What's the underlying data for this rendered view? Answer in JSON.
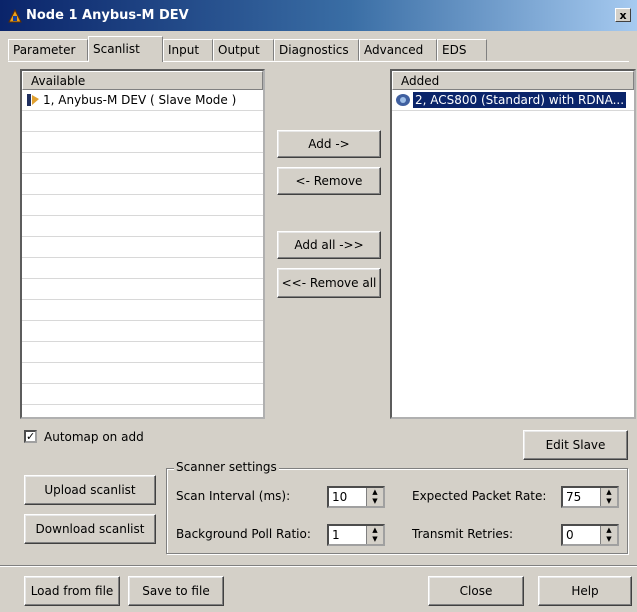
{
  "window": {
    "title": "Node 1 Anybus-M DEV",
    "close_label": "x"
  },
  "tabs": [
    {
      "label": "Parameter"
    },
    {
      "label": "Scanlist"
    },
    {
      "label": "Input"
    },
    {
      "label": "Output"
    },
    {
      "label": "Diagnostics"
    },
    {
      "label": "Advanced"
    },
    {
      "label": "EDS"
    }
  ],
  "available": {
    "header": "Available",
    "items": [
      {
        "label": "1, Anybus-M DEV ( Slave Mode )",
        "icon": "device-icon"
      }
    ]
  },
  "added": {
    "header": "Added",
    "items": [
      {
        "label": "2, ACS800 (Standard) with RDNA...",
        "icon": "drive-icon",
        "selected": true
      }
    ]
  },
  "buttons": {
    "add": "Add ->",
    "remove": "<- Remove",
    "add_all": "Add all ->>",
    "remove_all": "<<- Remove all",
    "edit_slave": "Edit Slave",
    "upload_scanlist": "Upload scanlist",
    "download_scanlist": "Download scanlist",
    "load_from_file": "Load from file",
    "save_to_file": "Save to file",
    "close": "Close",
    "help": "Help"
  },
  "automap": {
    "label": "Automap on add",
    "checked": true,
    "mark": "✓"
  },
  "scanner_settings": {
    "title": "Scanner settings",
    "scan_interval": {
      "label": "Scan Interval (ms):",
      "value": "10"
    },
    "background_poll": {
      "label": "Background Poll Ratio:",
      "value": "1"
    },
    "expected_packet_rate": {
      "label": "Expected Packet Rate:",
      "value": "75"
    },
    "transmit_retries": {
      "label": "Transmit Retries:",
      "value": "0"
    }
  },
  "colors": {
    "title_start": "#0a246a",
    "title_end": "#a6caf0",
    "face": "#d4d0c8",
    "selection": "#0a246a"
  }
}
